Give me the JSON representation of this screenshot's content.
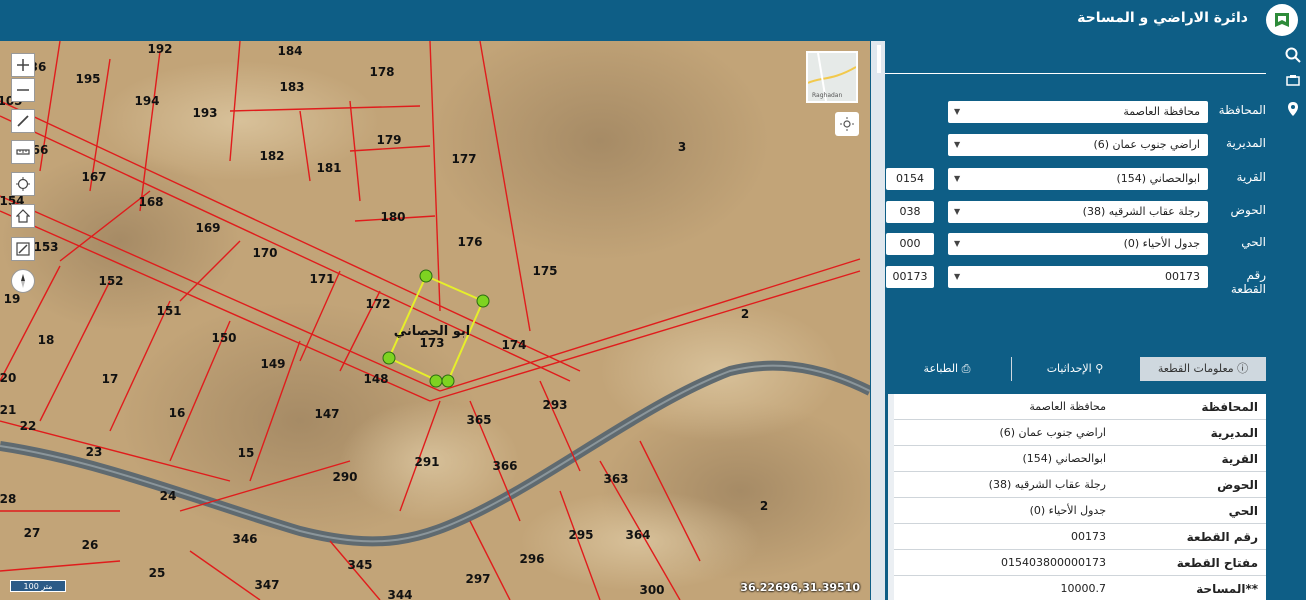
{
  "header": {
    "title": "دائرة الاراضي و المساحة"
  },
  "right_toolbar": [
    "search-icon",
    "print-map-icon",
    "location-pin-icon"
  ],
  "map": {
    "controls": [
      "zoom-in-icon",
      "zoom-out-icon",
      "draw-icon",
      "measure-icon",
      "locate-icon",
      "home-icon",
      "edit-map-icon",
      "compass-icon"
    ],
    "minimap_label": "Raghadan",
    "coordinates": "36.22696,31.39510",
    "scale_label": "100 متر",
    "parcel_labels": [
      "192",
      "184",
      "195",
      "178",
      "194",
      "183",
      "193",
      "179",
      "66",
      "177",
      "3",
      "182",
      "181",
      "167",
      "168",
      "180",
      "169",
      "176",
      "170",
      "171",
      "175",
      "153",
      "152",
      "172",
      "2",
      "151",
      "173",
      "174",
      "150",
      "149",
      "148",
      "147",
      "18",
      "17",
      "20",
      "16",
      "21",
      "22",
      "15",
      "365",
      "293",
      "23",
      "291",
      "366",
      "290",
      "363",
      "28",
      "24",
      "2",
      "27",
      "26",
      "346",
      "295",
      "364",
      "296",
      "25",
      "345",
      "347",
      "297",
      "344",
      "300",
      "19",
      "154",
      "105",
      "36"
    ],
    "highlight_label": "ابو الحصاني",
    "highlight_number": "173"
  },
  "filters": [
    {
      "label": "المحافظة",
      "value": "محافظة العاصمة",
      "code": ""
    },
    {
      "label": "المديرية",
      "value": "اراضي جنوب عمان (6)",
      "code": ""
    },
    {
      "label": "القرية",
      "value": "ابوالحصاني (154)",
      "code": "0154"
    },
    {
      "label": "الحوض",
      "value": "رجلة عقاب الشرقيه (38)",
      "code": "038"
    },
    {
      "label": "الحي",
      "value": "جدول الأحياء (0)",
      "code": "000"
    },
    {
      "label": "رقم القطعة",
      "value": "00173",
      "code": "00173"
    }
  ],
  "tabs": [
    {
      "label": "معلومات القطعة",
      "icon": "info-icon",
      "active": true
    },
    {
      "label": "الإحداثيات",
      "icon": "user-location-icon",
      "active": false
    },
    {
      "label": "الطباعة",
      "icon": "print-icon",
      "active": false
    }
  ],
  "info_rows": [
    {
      "label": "المحافظة",
      "value": "محافظة العاصمة"
    },
    {
      "label": "المديرية",
      "value": "اراضي جنوب عمان (6)"
    },
    {
      "label": "القرية",
      "value": "ابوالحصاني (154)"
    },
    {
      "label": "الحوض",
      "value": "رجلة عقاب الشرقيه (38)"
    },
    {
      "label": "الحي",
      "value": "جدول الأحياء (0)"
    },
    {
      "label": "رقم القطعة",
      "value": "00173"
    },
    {
      "label": "مفتاح القطعة",
      "value": "015403800000173"
    },
    {
      "label": "**المساحة",
      "value": "10000.7"
    }
  ]
}
